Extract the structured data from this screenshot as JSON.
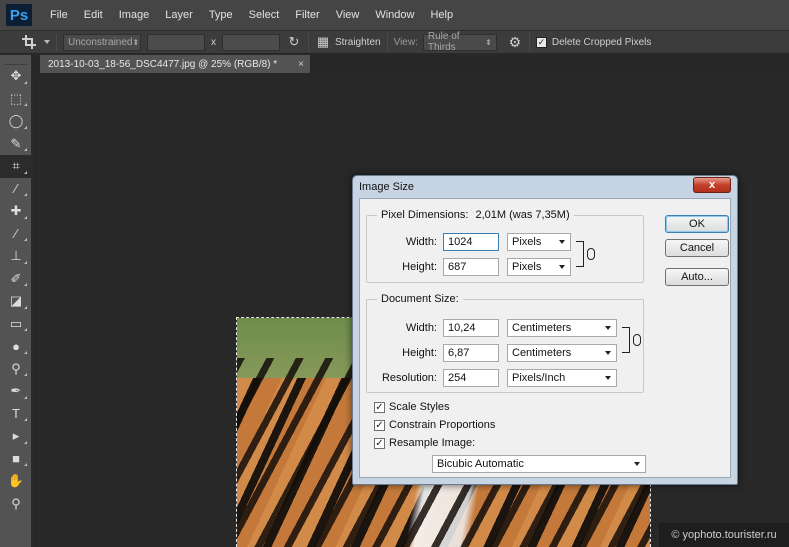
{
  "app": {
    "logo": "Ps"
  },
  "menu": [
    "File",
    "Edit",
    "Image",
    "Layer",
    "Type",
    "Select",
    "Filter",
    "View",
    "Window",
    "Help"
  ],
  "options_bar": {
    "ratio_preset": "Unconstrained",
    "swap_symbol": "x",
    "straighten_label": "Straighten",
    "view_label": "View:",
    "view_value": "Rule of Thirds",
    "delete_cropped_label": "Delete Cropped Pixels",
    "delete_cropped_checked": true
  },
  "document_tab": {
    "title": "2013-10-03_18-56_DSC4477.jpg @ 25% (RGB/8) *",
    "close": "×"
  },
  "tools": [
    "move-icon",
    "marquee-icon",
    "lasso-icon",
    "quick-select-icon",
    "crop-icon",
    "eyedropper-icon",
    "healing-brush-icon",
    "brush-icon",
    "clone-stamp-icon",
    "history-brush-icon",
    "eraser-icon",
    "gradient-icon",
    "blur-icon",
    "dodge-icon",
    "pen-icon",
    "type-icon",
    "path-select-icon",
    "shape-icon",
    "hand-icon",
    "zoom-icon"
  ],
  "dialog": {
    "title": "Image Size",
    "close_symbol": "x",
    "pixel_dimensions": {
      "label": "Pixel Dimensions:",
      "value": "2,01M (was 7,35M)",
      "width_label": "Width:",
      "width_value": "1024",
      "width_unit": "Pixels",
      "height_label": "Height:",
      "height_value": "687",
      "height_unit": "Pixels"
    },
    "document_size": {
      "label": "Document Size:",
      "width_label": "Width:",
      "width_value": "10,24",
      "width_unit": "Centimeters",
      "height_label": "Height:",
      "height_value": "6,87",
      "height_unit": "Centimeters",
      "resolution_label": "Resolution:",
      "resolution_value": "254",
      "resolution_unit": "Pixels/Inch"
    },
    "checkboxes": {
      "scale_styles": "Scale Styles",
      "constrain_proportions": "Constrain Proportions",
      "resample_image": "Resample Image:"
    },
    "resample_method": "Bicubic Automatic",
    "buttons": {
      "ok": "OK",
      "cancel": "Cancel",
      "auto": "Auto..."
    }
  },
  "watermark": "© yophoto.tourister.ru"
}
